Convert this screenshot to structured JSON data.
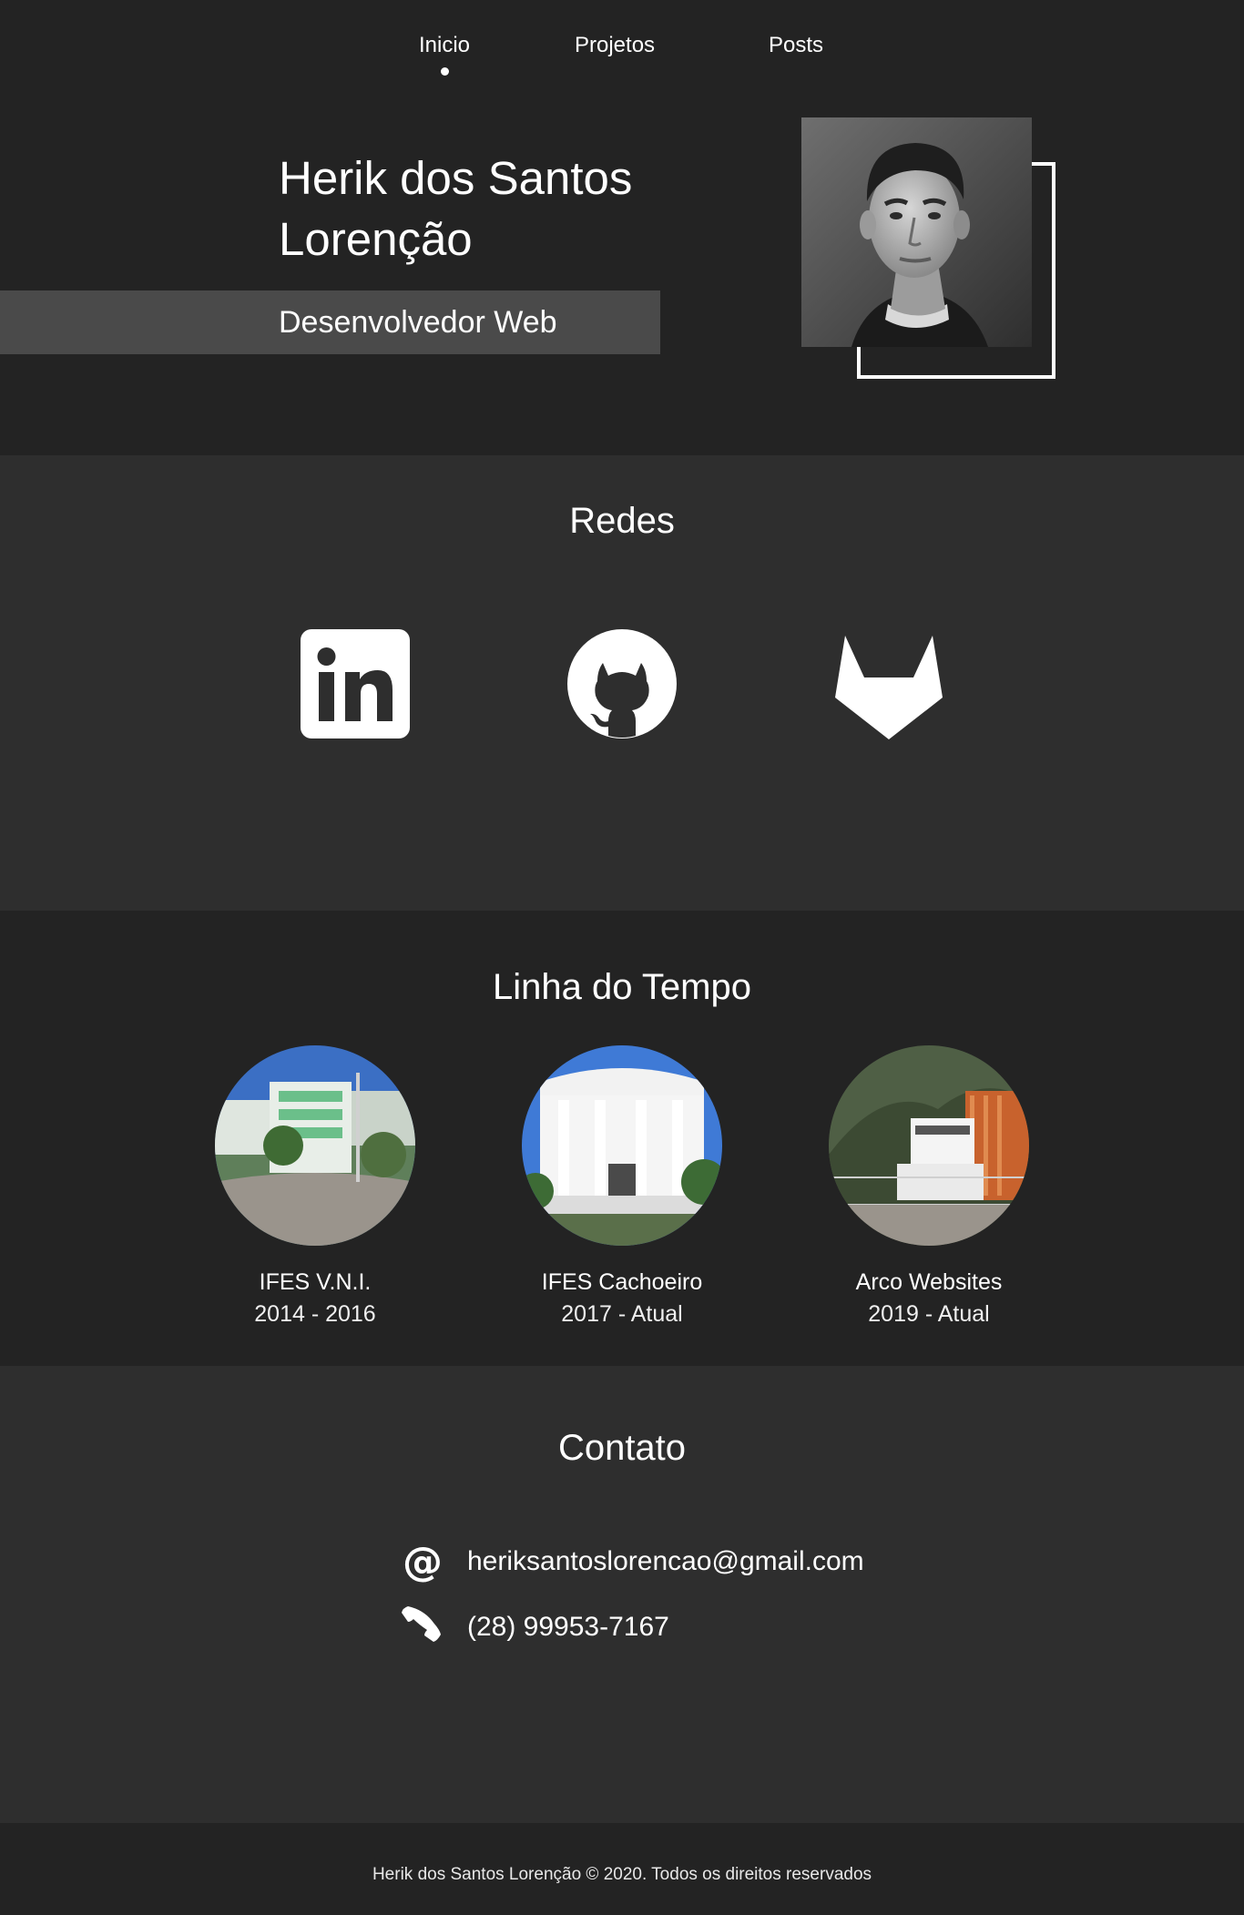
{
  "nav": {
    "items": [
      {
        "label": "Inicio",
        "active": true
      },
      {
        "label": "Projetos",
        "active": false
      },
      {
        "label": "Posts",
        "active": false
      }
    ]
  },
  "hero": {
    "name": "Herik dos Santos Lorenção",
    "role": "Desenvolvedor Web",
    "photo_alt": "Herik dos Santos Lorenção"
  },
  "redes": {
    "title": "Redes",
    "links": [
      {
        "icon": "linkedin-icon"
      },
      {
        "icon": "github-icon"
      },
      {
        "icon": "gitlab-icon"
      }
    ]
  },
  "timeline": {
    "title": "Linha do Tempo",
    "items": [
      {
        "name": "IFES V.N.I.",
        "years": "2014 - 2016"
      },
      {
        "name": "IFES Cachoeiro",
        "years": "2017 - Atual"
      },
      {
        "name": "Arco Websites",
        "years": "2019 - Atual"
      }
    ]
  },
  "contact": {
    "title": "Contato",
    "email": "heriksantoslorencao@gmail.com",
    "phone": "(28) 99953-7167",
    "email_icon": "at-icon",
    "phone_icon": "phone-icon"
  },
  "footer": {
    "text": "Herik dos Santos Lorenção © 2020. Todos os direitos reservados"
  },
  "colors": {
    "background_dark": "#232323",
    "background_light": "#2e2e2e",
    "role_band": "#4a4a4a",
    "text": "#ffffff"
  }
}
